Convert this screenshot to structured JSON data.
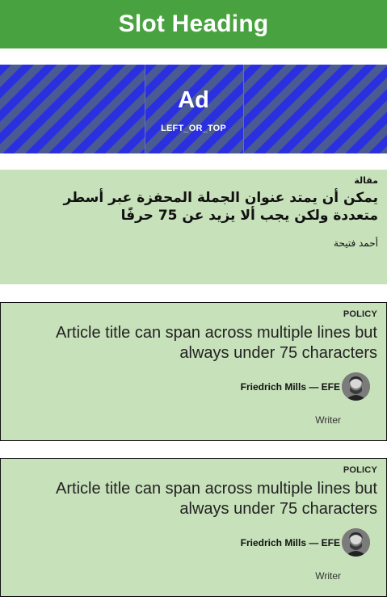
{
  "slot": {
    "heading": "Slot Heading"
  },
  "ad": {
    "label": "Ad",
    "position": "LEFT_OR_TOP"
  },
  "cards": [
    {
      "kicker": "مقالة",
      "title": "يمكن أن يمتد عنوان الجملة المحفزة عبر أسطر متعددة ولكن يجب ألا يزيد عن 75 حرفًا",
      "author": "أحمد فتيحة"
    },
    {
      "kicker": "POLICY",
      "title": "Article title can span across multiple lines but always under 75 characters",
      "byline": "Friedrich Mills — EFE",
      "role": "Writer"
    },
    {
      "kicker": "POLICY",
      "title": "Article title can span across multiple lines but always under 75 characters",
      "byline": "Friedrich Mills — EFE",
      "role": "Writer"
    }
  ],
  "colors": {
    "heading_bg": "#48a23f",
    "card_bg": "#c7e1ba",
    "ad_stripe_a": "#2a2fe0",
    "ad_stripe_b": "#4a5a93"
  },
  "icons": {
    "avatar": "author-avatar"
  }
}
